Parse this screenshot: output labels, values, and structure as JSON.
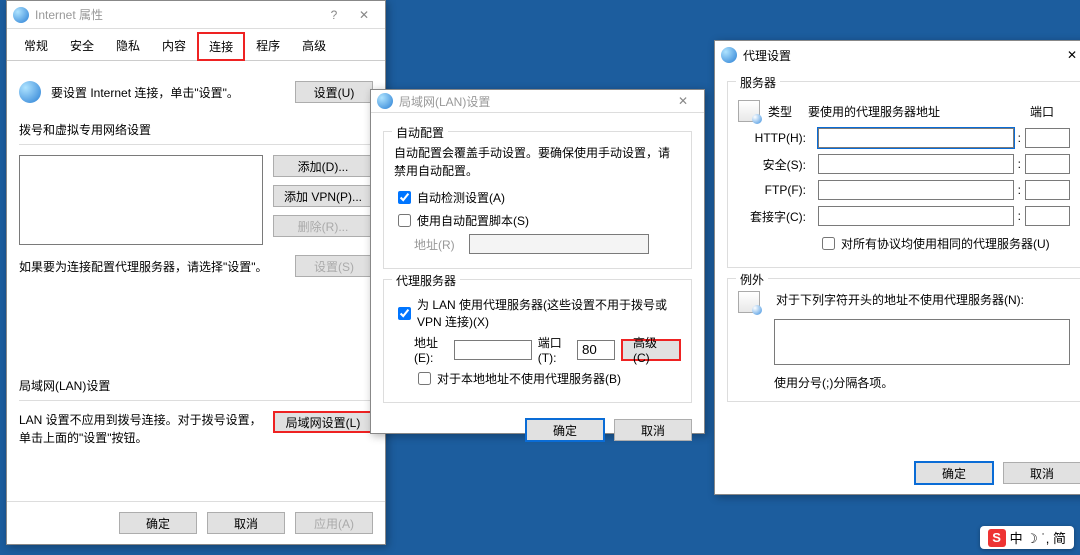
{
  "internet_props": {
    "title": "Internet 属性",
    "tabs": [
      "常规",
      "安全",
      "隐私",
      "内容",
      "连接",
      "程序",
      "高级"
    ],
    "active_tab": "连接",
    "setup_line": "要设置 Internet 连接，单击\"设置\"。",
    "btn_setup": "设置(U)",
    "dialup_heading": "拨号和虚拟专用网络设置",
    "btn_add": "添加(D)...",
    "btn_add_vpn": "添加 VPN(P)...",
    "btn_remove": "删除(R)...",
    "btn_settings2": "设置(S)",
    "proxy_note": "如果要为连接配置代理服务器，请选择\"设置\"。",
    "lan_heading": "局域网(LAN)设置",
    "lan_note": "LAN 设置不应用到拨号连接。对于拨号设置，单击上面的\"设置\"按钮。",
    "btn_lan": "局域网设置(L)",
    "btn_ok": "确定",
    "btn_cancel": "取消",
    "btn_apply": "应用(A)"
  },
  "lan": {
    "title": "局域网(LAN)设置",
    "auto_group": "自动配置",
    "auto_note": "自动配置会覆盖手动设置。要确保使用手动设置，请禁用自动配置。",
    "auto_detect": "自动检测设置(A)",
    "auto_script": "使用自动配置脚本(S)",
    "addr_label": "地址(R)",
    "proxy_group": "代理服务器",
    "proxy_use": "为 LAN 使用代理服务器(这些设置不用于拨号或 VPN 连接)(X)",
    "addr2_label": "地址(E):",
    "port_label": "端口(T):",
    "port_value": "80",
    "btn_advanced": "高级(C)",
    "bypass_local": "对于本地地址不使用代理服务器(B)",
    "btn_ok": "确定",
    "btn_cancel": "取消"
  },
  "proxy": {
    "title": "代理设置",
    "server_group": "服务器",
    "col_type": "类型",
    "col_addr": "要使用的代理服务器地址",
    "col_port": "端口",
    "rows": [
      "HTTP(H):",
      "安全(S):",
      "FTP(F):",
      "套接字(C):"
    ],
    "same_for_all": "对所有协议均使用相同的代理服务器(U)",
    "except_group": "例外",
    "except_note": "对于下列字符开头的地址不使用代理服务器(N):",
    "sep_note": "使用分号(;)分隔各项。",
    "btn_ok": "确定",
    "btn_cancel": "取消"
  },
  "ime": {
    "s": "S",
    "text": "中 ☽ ˙, 简"
  }
}
